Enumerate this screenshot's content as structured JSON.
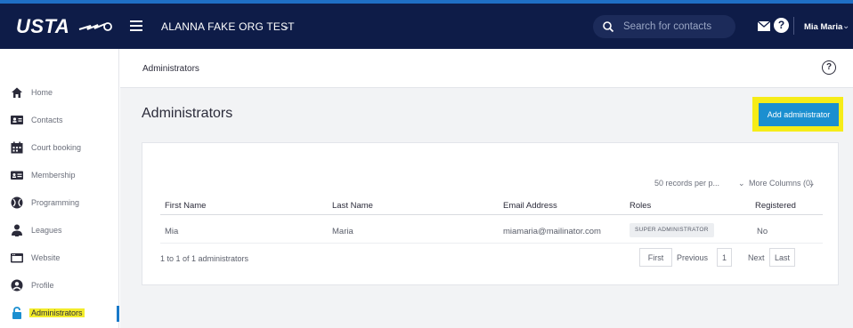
{
  "brand": {
    "logo_text": "USTA"
  },
  "header": {
    "org_name": "ALANNA FAKE ORG TEST",
    "search_placeholder": "Search for contacts",
    "user_name": "Mia Maria"
  },
  "sidebar": {
    "items": [
      {
        "label": "Home",
        "icon": "home-icon"
      },
      {
        "label": "Contacts",
        "icon": "contacts-icon"
      },
      {
        "label": "Court booking",
        "icon": "calendar-icon"
      },
      {
        "label": "Membership",
        "icon": "membership-card-icon"
      },
      {
        "label": "Programming",
        "icon": "tennis-ball-icon"
      },
      {
        "label": "Leagues",
        "icon": "leagues-icon"
      },
      {
        "label": "Website",
        "icon": "website-icon"
      },
      {
        "label": "Profile",
        "icon": "profile-icon"
      },
      {
        "label": "Administrators",
        "icon": "lock-icon"
      }
    ]
  },
  "main": {
    "breadcrumb": "Administrators",
    "title": "Administrators",
    "add_button": "Add administrator"
  },
  "table": {
    "records_per_page": "50 records per p...",
    "more_columns": "More Columns (0)",
    "headers": [
      "First Name",
      "Last Name",
      "Email Address",
      "Roles",
      "Registered"
    ],
    "rows": [
      {
        "first": "Mia",
        "last": "Maria",
        "email": "miamaria@mailinator.com",
        "role": "SUPER ADMINISTRATOR",
        "registered": "No"
      }
    ],
    "count_text": "1 to 1 of 1 administrators",
    "pagination": {
      "first": "First",
      "previous": "Previous",
      "page": "1",
      "next": "Next",
      "last": "Last"
    }
  },
  "colors": {
    "nav": "#0e1c48",
    "accent": "#1b8fd0",
    "highlight": "#f6ec18"
  }
}
